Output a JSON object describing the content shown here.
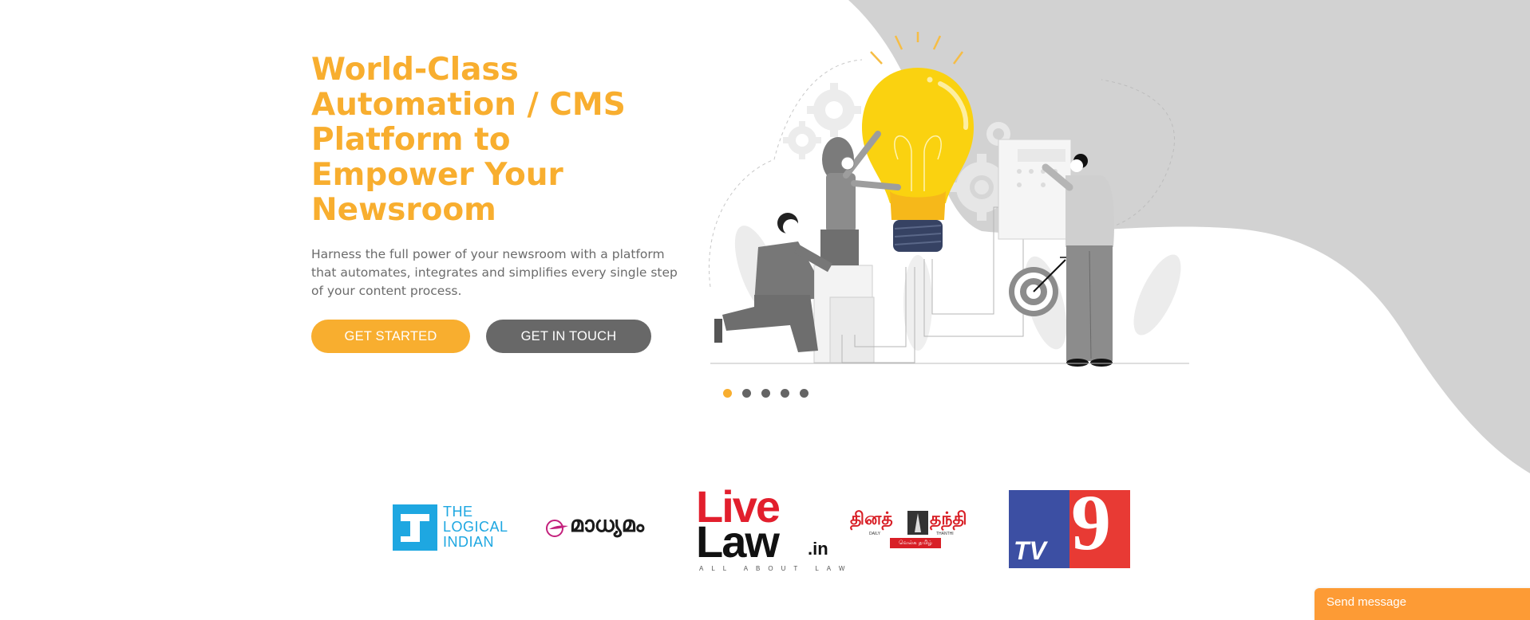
{
  "hero": {
    "title": "World-Class Automation / CMS Platform to Empower Your Newsroom",
    "subtitle": "Harness the full power of your newsroom with a platform that automates, integrates and simplifies every single step of your content process.",
    "primary_button": "GET STARTED",
    "secondary_button": "GET IN TOUCH"
  },
  "illustration": {
    "description": "Team collaborating around a giant light bulb with gears, target and control panel",
    "icons": [
      "light-bulb-icon",
      "gear-icon",
      "target-icon",
      "arrow-icon",
      "control-panel-icon"
    ]
  },
  "carousel": {
    "slide_count": 5,
    "active_index": 0
  },
  "clients": {
    "logos": [
      {
        "name": "The Logical Indian",
        "line1": "THE",
        "line2": "LOGICAL",
        "line3": "INDIAN"
      },
      {
        "name": "Madhyamam",
        "text": "മാധ്യമം"
      },
      {
        "name": "LiveLaw.in",
        "line1": "Live",
        "line2": "Law",
        "suffix": ".in",
        "tagline": "ALL ABOUT LAW"
      },
      {
        "name": "Daily Thanthi",
        "text_left": "தினத்",
        "text_right": "தந்தி",
        "daily": "DAILY",
        "thanthi": "THANTHI",
        "ribbon": "வெல்க தமிழ்"
      },
      {
        "name": "TV9",
        "tv": "TV",
        "nine": "9"
      }
    ]
  },
  "chat": {
    "label": "Send message"
  },
  "colors": {
    "accent": "#f8ae2f",
    "secondary": "#686868",
    "blob": "#d2d2d2",
    "chat": "#fd9b35"
  }
}
